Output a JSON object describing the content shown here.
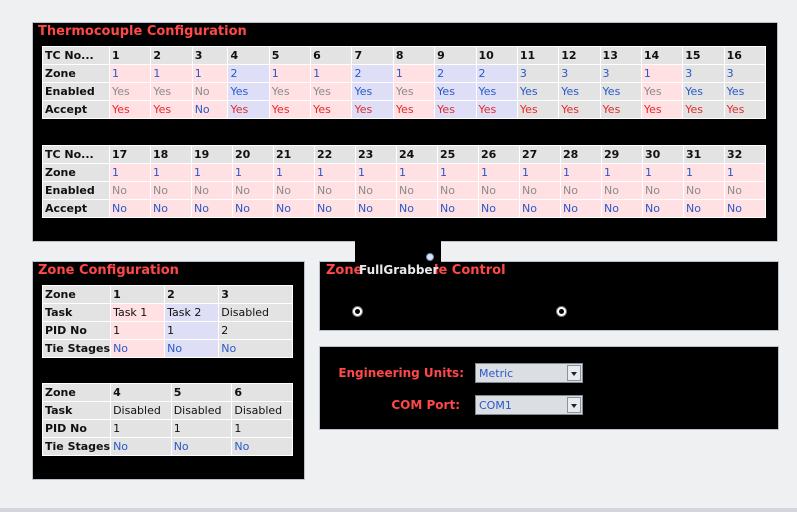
{
  "thermocouple": {
    "title": "Thermocouple Configuration",
    "row_labels": [
      "TC No...",
      "Zone",
      "Enabled",
      "Accept"
    ],
    "table1": {
      "numbers": [
        "1",
        "2",
        "3",
        "4",
        "5",
        "6",
        "7",
        "8",
        "9",
        "10",
        "11",
        "12",
        "13",
        "14",
        "15",
        "16"
      ],
      "zones": [
        "1",
        "1",
        "1",
        "2",
        "1",
        "1",
        "2",
        "1",
        "2",
        "2",
        "3",
        "3",
        "3",
        "1",
        "3",
        "3"
      ],
      "enabled": [
        "Yes",
        "Yes",
        "No",
        "Yes",
        "Yes",
        "Yes",
        "Yes",
        "Yes",
        "Yes",
        "Yes",
        "Yes",
        "Yes",
        "Yes",
        "Yes",
        "Yes",
        "Yes"
      ],
      "accept": [
        "Yes",
        "Yes",
        "No",
        "Yes",
        "Yes",
        "Yes",
        "Yes",
        "Yes",
        "Yes",
        "Yes",
        "Yes",
        "Yes",
        "Yes",
        "Yes",
        "Yes",
        "Yes"
      ]
    },
    "table2": {
      "numbers": [
        "17",
        "18",
        "19",
        "20",
        "21",
        "22",
        "23",
        "24",
        "25",
        "26",
        "27",
        "28",
        "29",
        "30",
        "31",
        "32"
      ],
      "zones": [
        "1",
        "1",
        "1",
        "1",
        "1",
        "1",
        "1",
        "1",
        "1",
        "1",
        "1",
        "1",
        "1",
        "1",
        "1",
        "1"
      ],
      "enabled": [
        "No",
        "No",
        "No",
        "No",
        "No",
        "No",
        "No",
        "No",
        "No",
        "No",
        "No",
        "No",
        "No",
        "No",
        "No",
        "No"
      ],
      "accept": [
        "No",
        "No",
        "No",
        "No",
        "No",
        "No",
        "No",
        "No",
        "No",
        "No",
        "No",
        "No",
        "No",
        "No",
        "No",
        "No"
      ]
    }
  },
  "zone_config": {
    "title": "Zone Configuration",
    "row_labels": [
      "Zone",
      "Task",
      "PID No",
      "Tie Stages"
    ],
    "table1": {
      "zones": [
        "1",
        "2",
        "3"
      ],
      "tasks": [
        "Task 1",
        "Task 2",
        "Disabled"
      ],
      "pid": [
        "1",
        "1",
        "2"
      ],
      "tie": [
        "No",
        "No",
        "No"
      ]
    },
    "table2": {
      "zones": [
        "4",
        "5",
        "6"
      ],
      "tasks": [
        "Disabled",
        "Disabled",
        "Disabled"
      ],
      "pid": [
        "1",
        "1",
        "1"
      ],
      "tie": [
        "No",
        "No",
        "No"
      ]
    }
  },
  "zone_control": {
    "title_left": "Zone",
    "title_right": "le Control",
    "overlay_text": "FullGrabber"
  },
  "settings": {
    "eng_units_label": "Engineering Units:",
    "eng_units_value": "Metric",
    "com_port_label": "COM Port:",
    "com_port_value": "COM1"
  },
  "colors": {
    "title_red": "#ff4848",
    "zone1_bg": "#ffe0e3",
    "zone2_bg": "#dedef6",
    "zone3_bg": "#e3e3e3",
    "text_blue": "#2a58c8",
    "text_red": "#e8282a"
  }
}
